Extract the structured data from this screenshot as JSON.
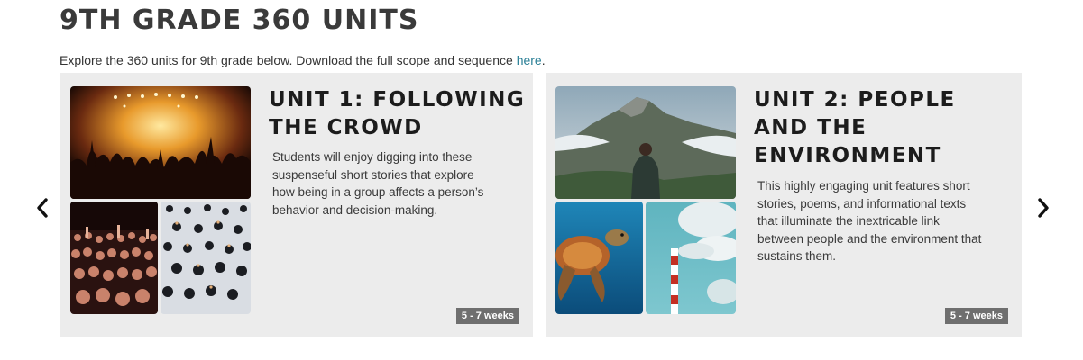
{
  "header": {
    "title": "9TH GRADE 360 UNITS",
    "intro_text": "Explore the 360 units for 9th grade below. Download the full scope and sequence ",
    "intro_link": "here",
    "intro_end": "."
  },
  "carousel": {
    "prev_icon": "chevron-left-icon",
    "next_icon": "chevron-right-icon",
    "cards": [
      {
        "title": "UNIT 1: FOLLOWING THE CROWD",
        "description": "Students will enjoy digging into these suspenseful short stories that explore how being in a group affects a person’s behavior and decision-making.",
        "duration": "5 - 7 weeks",
        "images": [
          "concert-crowd-image",
          "cheering-crowd-image",
          "marching-group-image"
        ]
      },
      {
        "title": "UNIT 2: PEOPLE AND THE ENVIRONMENT",
        "description": "This highly engaging unit features short stories, poems, and informational texts that illuminate the inextricable link between people and the environment that sustains them.",
        "duration": "5 - 7 weeks",
        "images": [
          "mountain-hiker-image",
          "sea-turtle-image",
          "smokestack-image"
        ]
      }
    ]
  }
}
